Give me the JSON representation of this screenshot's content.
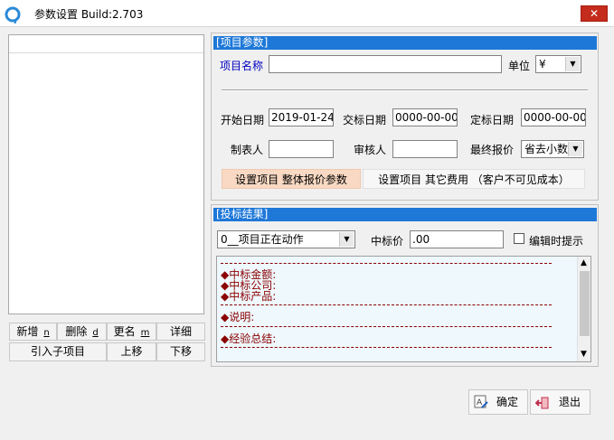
{
  "window": {
    "title": "参数设置  Build:2.703",
    "close_glyph": "✕"
  },
  "left_buttons": {
    "add": "新增",
    "add_key": "n",
    "delete": "删除",
    "delete_key": "d",
    "rename": "更名",
    "rename_key": "m",
    "detail": "详细",
    "import_sub": "引入子项目",
    "move_up": "上移",
    "move_down": "下移"
  },
  "project_params": {
    "header": "[项目参数]",
    "project_name_label": "项目名称",
    "project_name_value": "",
    "unit_label": "单位",
    "unit_value": "¥",
    "start_date_label": "开始日期",
    "start_date_value": "2019-01-24",
    "submit_date_label": "交标日期",
    "submit_date_value": "0000-00-00",
    "award_date_label": "定标日期",
    "award_date_value": "0000-00-00",
    "preparer_label": "制表人",
    "preparer_value": "",
    "reviewer_label": "审核人",
    "reviewer_value": "",
    "final_quote_label": "最终报价",
    "final_quote_value": "省去小数",
    "tab_overall": "设置项目  整体报价参数",
    "tab_other": "设置项目  其它费用 （客户不可见成本）"
  },
  "bid_result": {
    "header": "[投标结果]",
    "status_value": "0__项目正在动作",
    "winning_price_label": "中标价",
    "winning_price_value": ".00",
    "edit_prompt_label": "编辑时提示",
    "edit_prompt_checked": false,
    "memo_lines": [
      "◆中标金额:",
      "◆中标公司:",
      "◆中标产品:",
      "◆说明:",
      "◆经验总结:"
    ]
  },
  "footer": {
    "ok": "确定",
    "exit": "退出"
  },
  "colors": {
    "header_blue": "#1e78d8",
    "memo_text": "#8b0000",
    "label_blue": "#0000c0",
    "tab_active": "#f9d9c3",
    "close_red": "#c42b1c"
  }
}
